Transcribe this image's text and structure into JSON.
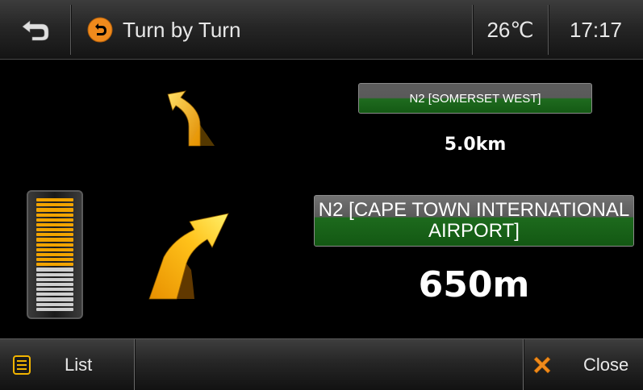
{
  "header": {
    "title": "Turn by Turn",
    "temperature": "26℃",
    "time": "17:17"
  },
  "instructions": [
    {
      "road": "N2 [SOMERSET WEST]",
      "distance": "5.0km",
      "direction": "keep-left"
    },
    {
      "road": "N2 [CAPE TOWN INTERNATIONAL AIRPORT]",
      "distance": "650m",
      "direction": "turn-right"
    }
  ],
  "footer": {
    "list_label": "List",
    "close_label": "Close"
  },
  "meter": {
    "active_segments": 14,
    "total_segments": 23,
    "active_color": "#f2a400",
    "inactive_color": "#cfcfcf"
  },
  "icons": {
    "back": "back-arrow-icon",
    "title": "u-turn-icon",
    "list": "list-icon",
    "close": "close-x-icon"
  },
  "colors": {
    "accent": "#f5a623",
    "sign_green": "#1a6b1a"
  }
}
